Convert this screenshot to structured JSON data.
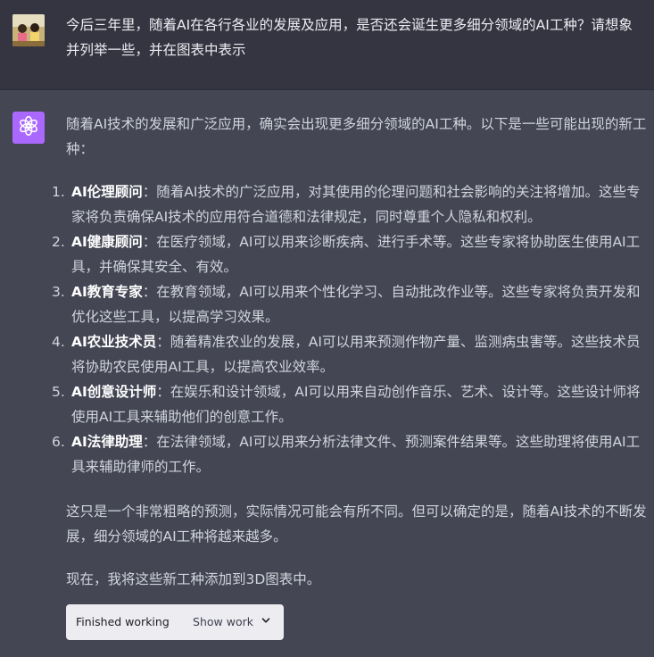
{
  "user": {
    "message": "今后三年里，随着AI在各行各业的发展及应用，是否还会诞生更多细分领域的AI工种？请想象并列举一些，并在图表中表示"
  },
  "assistant": {
    "intro": "随着AI技术的发展和广泛应用，确实会出现更多细分领域的AI工种。以下是一些可能出现的新工种：",
    "items": [
      {
        "num": "1.",
        "title": "AI伦理顾问",
        "desc": "：随着AI技术的广泛应用，对其使用的伦理问题和社会影响的关注将增加。这些专家将负责确保AI技术的应用符合道德和法律规定，同时尊重个人隐私和权利。"
      },
      {
        "num": "2.",
        "title": "AI健康顾问",
        "desc": "：在医疗领域，AI可以用来诊断疾病、进行手术等。这些专家将协助医生使用AI工具，并确保其安全、有效。"
      },
      {
        "num": "3.",
        "title": "AI教育专家",
        "desc": "：在教育领域，AI可以用来个性化学习、自动批改作业等。这些专家将负责开发和优化这些工具，以提高学习效果。"
      },
      {
        "num": "4.",
        "title": "AI农业技术员",
        "desc": "：随着精准农业的发展，AI可以用来预测作物产量、监测病虫害等。这些技术员将协助农民使用AI工具，以提高农业效率。"
      },
      {
        "num": "5.",
        "title": "AI创意设计师",
        "desc": "：在娱乐和设计领域，AI可以用来自动创作音乐、艺术、设计等。这些设计师将使用AI工具来辅助他们的创意工作。"
      },
      {
        "num": "6.",
        "title": "AI法律助理",
        "desc": "：在法律领域，AI可以用来分析法律文件、预测案件结果等。这些助理将使用AI工具来辅助律师的工作。"
      }
    ],
    "conclusion": "这只是一个非常粗略的预测，实际情况可能会有所不同。但可以确定的是，随着AI技术的不断发展，细分领域的AI工种将越来越多。",
    "now": "现在，我将这些新工种添加到3D图表中。",
    "tool": {
      "status": "Finished working",
      "toggle": "Show work"
    }
  },
  "icons": {
    "bot": "openai-logo-icon",
    "toggle": "chevron-down-icon"
  },
  "colors": {
    "user_bg": "#343541",
    "assistant_bg": "#444654",
    "bot_avatar_bg": "#ab68ff"
  }
}
